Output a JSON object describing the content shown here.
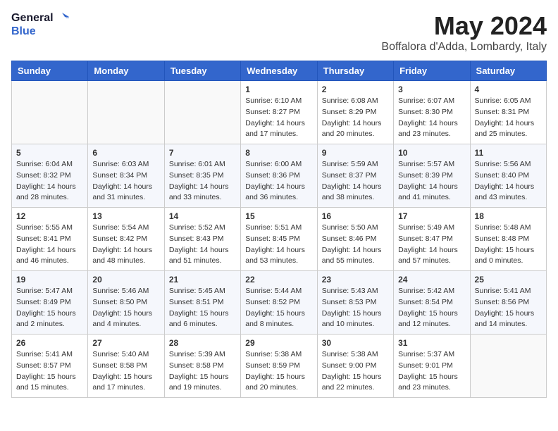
{
  "logo": {
    "line1": "General",
    "line2": "Blue"
  },
  "title": "May 2024",
  "location": "Boffalora d'Adda, Lombardy, Italy",
  "weekdays": [
    "Sunday",
    "Monday",
    "Tuesday",
    "Wednesday",
    "Thursday",
    "Friday",
    "Saturday"
  ],
  "weeks": [
    [
      {
        "day": "",
        "info": ""
      },
      {
        "day": "",
        "info": ""
      },
      {
        "day": "",
        "info": ""
      },
      {
        "day": "1",
        "info": "Sunrise: 6:10 AM\nSunset: 8:27 PM\nDaylight: 14 hours\nand 17 minutes."
      },
      {
        "day": "2",
        "info": "Sunrise: 6:08 AM\nSunset: 8:29 PM\nDaylight: 14 hours\nand 20 minutes."
      },
      {
        "day": "3",
        "info": "Sunrise: 6:07 AM\nSunset: 8:30 PM\nDaylight: 14 hours\nand 23 minutes."
      },
      {
        "day": "4",
        "info": "Sunrise: 6:05 AM\nSunset: 8:31 PM\nDaylight: 14 hours\nand 25 minutes."
      }
    ],
    [
      {
        "day": "5",
        "info": "Sunrise: 6:04 AM\nSunset: 8:32 PM\nDaylight: 14 hours\nand 28 minutes."
      },
      {
        "day": "6",
        "info": "Sunrise: 6:03 AM\nSunset: 8:34 PM\nDaylight: 14 hours\nand 31 minutes."
      },
      {
        "day": "7",
        "info": "Sunrise: 6:01 AM\nSunset: 8:35 PM\nDaylight: 14 hours\nand 33 minutes."
      },
      {
        "day": "8",
        "info": "Sunrise: 6:00 AM\nSunset: 8:36 PM\nDaylight: 14 hours\nand 36 minutes."
      },
      {
        "day": "9",
        "info": "Sunrise: 5:59 AM\nSunset: 8:37 PM\nDaylight: 14 hours\nand 38 minutes."
      },
      {
        "day": "10",
        "info": "Sunrise: 5:57 AM\nSunset: 8:39 PM\nDaylight: 14 hours\nand 41 minutes."
      },
      {
        "day": "11",
        "info": "Sunrise: 5:56 AM\nSunset: 8:40 PM\nDaylight: 14 hours\nand 43 minutes."
      }
    ],
    [
      {
        "day": "12",
        "info": "Sunrise: 5:55 AM\nSunset: 8:41 PM\nDaylight: 14 hours\nand 46 minutes."
      },
      {
        "day": "13",
        "info": "Sunrise: 5:54 AM\nSunset: 8:42 PM\nDaylight: 14 hours\nand 48 minutes."
      },
      {
        "day": "14",
        "info": "Sunrise: 5:52 AM\nSunset: 8:43 PM\nDaylight: 14 hours\nand 51 minutes."
      },
      {
        "day": "15",
        "info": "Sunrise: 5:51 AM\nSunset: 8:45 PM\nDaylight: 14 hours\nand 53 minutes."
      },
      {
        "day": "16",
        "info": "Sunrise: 5:50 AM\nSunset: 8:46 PM\nDaylight: 14 hours\nand 55 minutes."
      },
      {
        "day": "17",
        "info": "Sunrise: 5:49 AM\nSunset: 8:47 PM\nDaylight: 14 hours\nand 57 minutes."
      },
      {
        "day": "18",
        "info": "Sunrise: 5:48 AM\nSunset: 8:48 PM\nDaylight: 15 hours\nand 0 minutes."
      }
    ],
    [
      {
        "day": "19",
        "info": "Sunrise: 5:47 AM\nSunset: 8:49 PM\nDaylight: 15 hours\nand 2 minutes."
      },
      {
        "day": "20",
        "info": "Sunrise: 5:46 AM\nSunset: 8:50 PM\nDaylight: 15 hours\nand 4 minutes."
      },
      {
        "day": "21",
        "info": "Sunrise: 5:45 AM\nSunset: 8:51 PM\nDaylight: 15 hours\nand 6 minutes."
      },
      {
        "day": "22",
        "info": "Sunrise: 5:44 AM\nSunset: 8:52 PM\nDaylight: 15 hours\nand 8 minutes."
      },
      {
        "day": "23",
        "info": "Sunrise: 5:43 AM\nSunset: 8:53 PM\nDaylight: 15 hours\nand 10 minutes."
      },
      {
        "day": "24",
        "info": "Sunrise: 5:42 AM\nSunset: 8:54 PM\nDaylight: 15 hours\nand 12 minutes."
      },
      {
        "day": "25",
        "info": "Sunrise: 5:41 AM\nSunset: 8:56 PM\nDaylight: 15 hours\nand 14 minutes."
      }
    ],
    [
      {
        "day": "26",
        "info": "Sunrise: 5:41 AM\nSunset: 8:57 PM\nDaylight: 15 hours\nand 15 minutes."
      },
      {
        "day": "27",
        "info": "Sunrise: 5:40 AM\nSunset: 8:58 PM\nDaylight: 15 hours\nand 17 minutes."
      },
      {
        "day": "28",
        "info": "Sunrise: 5:39 AM\nSunset: 8:58 PM\nDaylight: 15 hours\nand 19 minutes."
      },
      {
        "day": "29",
        "info": "Sunrise: 5:38 AM\nSunset: 8:59 PM\nDaylight: 15 hours\nand 20 minutes."
      },
      {
        "day": "30",
        "info": "Sunrise: 5:38 AM\nSunset: 9:00 PM\nDaylight: 15 hours\nand 22 minutes."
      },
      {
        "day": "31",
        "info": "Sunrise: 5:37 AM\nSunset: 9:01 PM\nDaylight: 15 hours\nand 23 minutes."
      },
      {
        "day": "",
        "info": ""
      }
    ]
  ]
}
